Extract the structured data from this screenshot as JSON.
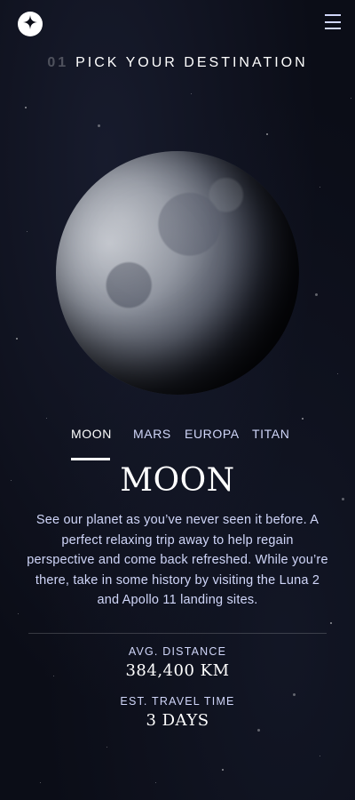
{
  "header": {
    "logo_icon": "star-logo-icon",
    "menu_icon": "hamburger-menu-icon"
  },
  "page": {
    "number": "01",
    "title": "PICK YOUR DESTINATION"
  },
  "tabs": [
    {
      "label": "MOON",
      "active": true
    },
    {
      "label": "MARS",
      "active": false
    },
    {
      "label": "EUROPA",
      "active": false
    },
    {
      "label": "TITAN",
      "active": false
    }
  ],
  "destination": {
    "name": "MOON",
    "description": "See our planet as you’ve never seen it before. A perfect relaxing trip away to help regain perspective and come back refreshed. While you’re there, take in some history by visiting the Luna 2 and Apollo 11 landing sites.",
    "stats": [
      {
        "label": "AVG. DISTANCE",
        "value": "384,400 KM"
      },
      {
        "label": "EST. TRAVEL TIME",
        "value": "3 DAYS"
      }
    ]
  },
  "colors": {
    "background": "#0b0d17",
    "light_accent": "#d0d6f9",
    "white": "#ffffff"
  }
}
